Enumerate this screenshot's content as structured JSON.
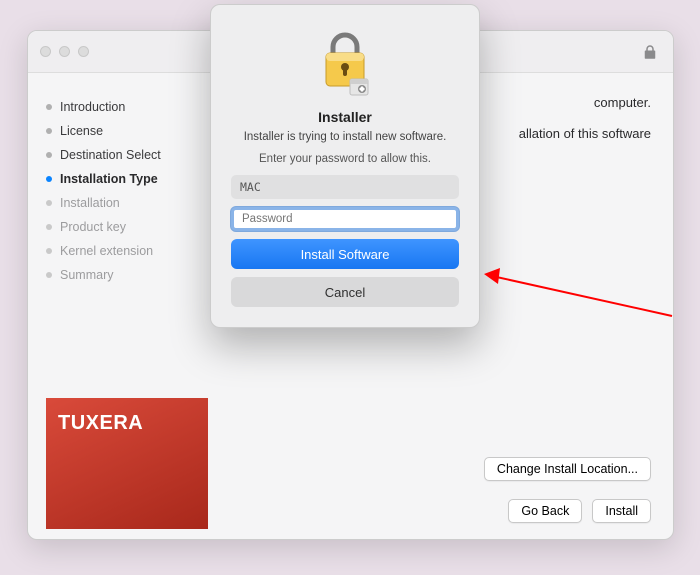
{
  "sidebar": {
    "items": [
      {
        "label": "Introduction",
        "state": "done"
      },
      {
        "label": "License",
        "state": "done"
      },
      {
        "label": "Destination Select",
        "state": "done"
      },
      {
        "label": "Installation Type",
        "state": "current"
      },
      {
        "label": "Installation",
        "state": "todo"
      },
      {
        "label": "Product key",
        "state": "todo"
      },
      {
        "label": "Kernel extension",
        "state": "todo"
      },
      {
        "label": "Summary",
        "state": "todo"
      }
    ]
  },
  "brand": {
    "name": "TUXERA"
  },
  "content": {
    "line1": "computer.",
    "line2": "allation of this software",
    "change_location": "Change Install Location...",
    "go_back": "Go Back",
    "install": "Install"
  },
  "modal": {
    "title": "Installer",
    "desc": "Installer is trying to install new software.",
    "sub": "Enter your password to allow this.",
    "username": "MAC",
    "password_placeholder": "Password",
    "primary": "Install Software",
    "secondary": "Cancel"
  },
  "colors": {
    "arrow": "#ff0000"
  }
}
